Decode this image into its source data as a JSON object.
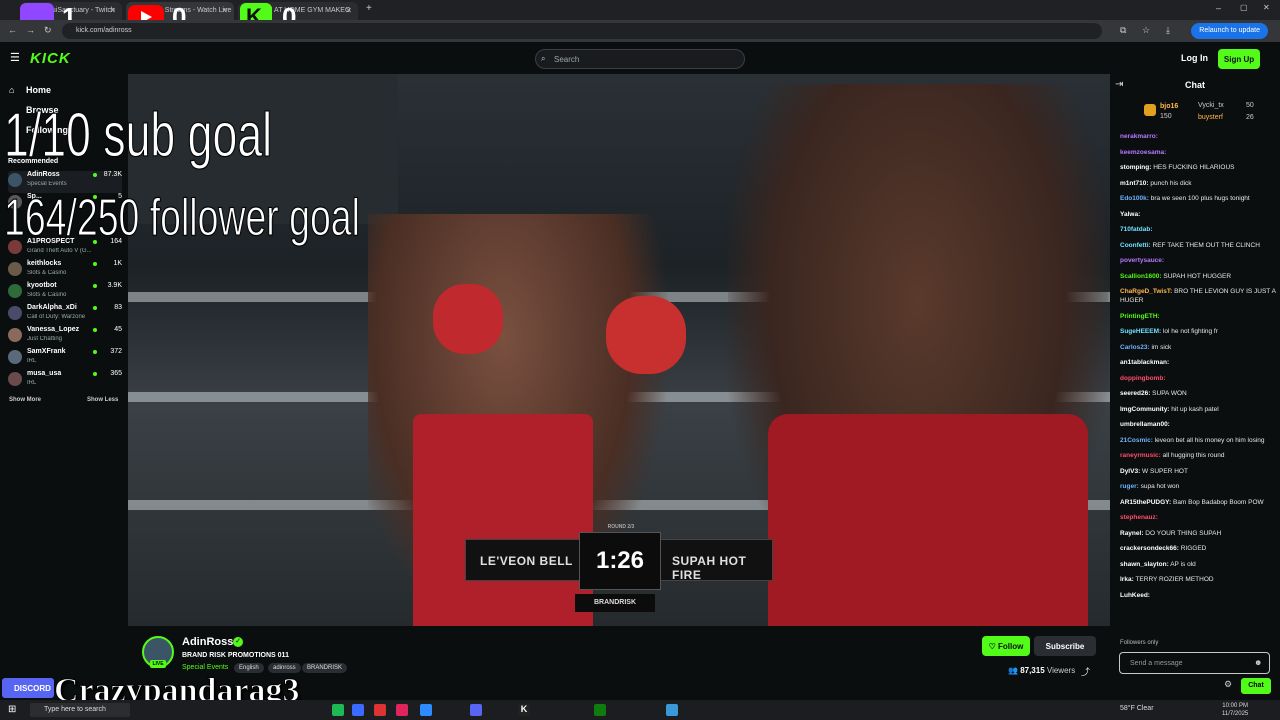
{
  "browser": {
    "tabs": [
      {
        "title": "YeuiSanctuary - Twitch"
      },
      {
        "title": "Live Streams - Watch Live"
      },
      {
        "title": "AM AT HOME GYM MAKEO"
      }
    ],
    "url": "kick.com/adinross",
    "relaunch": "Relaunch to update"
  },
  "overlay": {
    "counters": [
      {
        "icon": "twitch-icon",
        "value": "1",
        "color": "#9146ff"
      },
      {
        "icon": "youtube-icon",
        "value": "0",
        "color": "#ff0000"
      },
      {
        "icon": "kick-icon",
        "value": "0",
        "color": "#53fc18"
      }
    ],
    "sub_goal": "1/10 sub goal",
    "follower_goal": "164/250 follower goal",
    "watermark": "Crazypandarag3",
    "discord": "DISCORD"
  },
  "topbar": {
    "logo": "KICK",
    "search_placeholder": "Search",
    "login": "Log In",
    "signup": "Sign Up"
  },
  "sidebar": {
    "nav": [
      {
        "label": "Home"
      },
      {
        "label": "Browse"
      },
      {
        "label": "Following"
      }
    ],
    "recommended": "Recommended",
    "channels": [
      {
        "name": "AdinRoss",
        "category": "Special Events",
        "viewers": "87.3K"
      },
      {
        "name": "Sp...",
        "category": "",
        "viewers": "5"
      },
      {
        "name": "",
        "category": "",
        "viewers": ""
      },
      {
        "name": "A1PROSPECT",
        "category": "Grand Theft Auto V (G...",
        "viewers": "164"
      },
      {
        "name": "keithlocks",
        "category": "Slots & Casino",
        "viewers": "1K"
      },
      {
        "name": "kyootbot",
        "category": "Slots & Casino",
        "viewers": "3.9K"
      },
      {
        "name": "DarkAlpha_xDi",
        "category": "Call of Duty: Warzone",
        "viewers": "83"
      },
      {
        "name": "Vanessa_Lopez",
        "category": "Just Chatting",
        "viewers": "45"
      },
      {
        "name": "SamXFrank",
        "category": "IRL",
        "viewers": "372"
      },
      {
        "name": "musa_usa",
        "category": "IRL",
        "viewers": "365"
      }
    ],
    "show_more": "Show More",
    "show_less": "Show Less"
  },
  "video": {
    "fighter_left": "LE'VEON BELL",
    "fighter_right": "SUPAH HOT FIRE",
    "round": "ROUND 2/3",
    "timer": "1:26",
    "brand": "BRANDRISK"
  },
  "stream_info": {
    "streamer": "AdinRoss",
    "live": "LIVE",
    "title": "BRAND RISK PROMOTIONS 011",
    "category": "Special Events",
    "tags": [
      "English",
      "adinross",
      "BRANDRISK"
    ],
    "follow": "Follow",
    "subscribe": "Subscribe",
    "viewers": "87,315",
    "viewers_label": "Viewers"
  },
  "chat": {
    "header": "Chat",
    "pinned": [
      {
        "name": "bjo16",
        "value": "150"
      },
      {
        "name": "Vycki_tx",
        "value": "50"
      },
      {
        "name": "buysterf",
        "value": "26"
      }
    ],
    "messages": [
      {
        "user": "nerakmarro:",
        "text": "",
        "color": "#b57aff"
      },
      {
        "user": "keemzoesama:",
        "text": "",
        "color": "#b57aff"
      },
      {
        "user": "stomping:",
        "text": "HES FUCKING HILARIOUS",
        "color": "#ffffff"
      },
      {
        "user": "m1nt710:",
        "text": "punch his dick",
        "color": "#ffffff"
      },
      {
        "user": "Edo100k:",
        "text": "bra we seen 100 plus hugs tonight",
        "color": "#6fb3ff"
      },
      {
        "user": "Yalwa:",
        "text": "",
        "color": "#ffffff"
      },
      {
        "user": "710fatdab:",
        "text": "",
        "color": "#6fe0ff"
      },
      {
        "user": "Coonfetti:",
        "text": "REF TAKE THEM OUT THE CLINCH",
        "color": "#6fe0ff"
      },
      {
        "user": "povertysauce:",
        "text": "",
        "color": "#b57aff"
      },
      {
        "user": "Scallion1600:",
        "text": "SUPAH HOT HUGGER",
        "color": "#53fc18"
      },
      {
        "user": "ChaRgeD_TwisT:",
        "text": "BRO THE LEVION GUY IS JUST A HUGER",
        "color": "#ffb84d"
      },
      {
        "user": "PrintingETH:",
        "text": "",
        "color": "#53fc18"
      },
      {
        "user": "SugeHEEEM:",
        "text": "lol he not fighting fr",
        "color": "#6fe0ff"
      },
      {
        "user": "Carlos23:",
        "text": "im sick",
        "color": "#6fb3ff"
      },
      {
        "user": "an1tablackman:",
        "text": "",
        "color": "#ffffff"
      },
      {
        "user": "doppingbomb:",
        "text": "",
        "color": "#ff4d6d"
      },
      {
        "user": "seered26:",
        "text": "SUPA WON",
        "color": "#ffffff"
      },
      {
        "user": "ImgCommunity:",
        "text": "hit up kash patel",
        "color": "#ffffff"
      },
      {
        "user": "umbrellaman00:",
        "text": "",
        "color": "#ffffff"
      },
      {
        "user": "21Cosmic:",
        "text": "leveon bet all his money on him losing",
        "color": "#6fb3ff"
      },
      {
        "user": "raneyrmusic:",
        "text": "all hugging this round",
        "color": "#ff4d6d"
      },
      {
        "user": "DylV3:",
        "text": "W SUPER HOT",
        "color": "#ffffff"
      },
      {
        "user": "ruger:",
        "text": "supa hot won",
        "color": "#6fb3ff"
      },
      {
        "user": "AR15thePUDGY:",
        "text": "Bam Bop Badabop Boom POW",
        "color": "#ffffff"
      },
      {
        "user": "stephenauz:",
        "text": "",
        "color": "#ff4d6d"
      },
      {
        "user": "Raynel:",
        "text": "DO YOUR THING SUPAH",
        "color": "#ffffff"
      },
      {
        "user": "crackersondeck66:",
        "text": "RIGGED",
        "color": "#ffffff"
      },
      {
        "user": "shawn_slayton:",
        "text": "AP is old",
        "color": "#ffffff"
      },
      {
        "user": "lrka:",
        "text": "TERRY ROZIER METHOD",
        "color": "#ffffff"
      },
      {
        "user": "LuhKeed:",
        "text": "",
        "color": "#ffffff"
      }
    ],
    "followers_only": "Followers only",
    "input_placeholder": "Send a message",
    "send": "Chat"
  },
  "taskbar": {
    "search": "Type here to search",
    "weather": "58°F Clear",
    "time": "10:00 PM",
    "date": "11/7/2025"
  }
}
